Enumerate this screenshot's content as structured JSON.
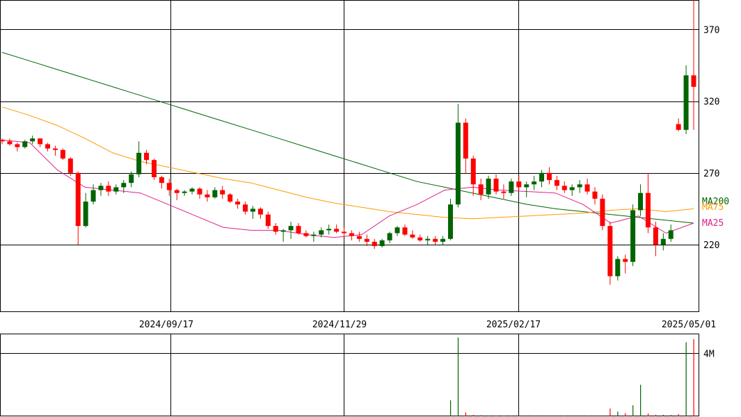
{
  "chart_data": {
    "type": "candlestick",
    "x_tick_labels": [
      "2024/09/17",
      "2024/11/29",
      "2025/02/17",
      "2025/05/01"
    ],
    "price_axis": {
      "ticks": [
        220,
        270,
        320,
        370
      ],
      "ylim": [
        173.5,
        390.5
      ]
    },
    "volume_axis": {
      "ticks": [
        {
          "value": 4000000,
          "label": "4M"
        }
      ],
      "ylim": [
        0,
        5200000
      ]
    },
    "grid": true,
    "moving_averages": [
      {
        "name": "MA200",
        "color": "#006400",
        "values": [
          354,
          348,
          342,
          336,
          330,
          324,
          318,
          312,
          306,
          300,
          294,
          288,
          282,
          276,
          270,
          264,
          260,
          256,
          252,
          248,
          245,
          243,
          241,
          239,
          237,
          235
        ]
      },
      {
        "name": "MA75",
        "color": "#ff9900",
        "values": [
          316,
          310,
          303,
          294,
          284,
          278,
          274,
          270,
          266,
          263,
          258,
          253,
          249,
          246,
          243,
          241,
          239,
          238,
          239,
          240,
          241,
          242,
          244,
          245,
          243,
          245
        ]
      },
      {
        "name": "MA25",
        "color": "#e0208a",
        "values": [
          293,
          291,
          272,
          260,
          258,
          256,
          248,
          240,
          232,
          230,
          230,
          227,
          225,
          227,
          240,
          248,
          258,
          260,
          258,
          257,
          256,
          248,
          235,
          240,
          228,
          235
        ]
      }
    ],
    "candles": [
      [
        293,
        294,
        290,
        292
      ],
      [
        292,
        294,
        289,
        290
      ],
      [
        290,
        291,
        285,
        288
      ],
      [
        288,
        293,
        287,
        292
      ],
      [
        292,
        296,
        290,
        294
      ],
      [
        294,
        294,
        288,
        290
      ],
      [
        290,
        291,
        285,
        287
      ],
      [
        287,
        289,
        282,
        286
      ],
      [
        286,
        287,
        279,
        280
      ],
      [
        280,
        281,
        268,
        270
      ],
      [
        270,
        271,
        220,
        233
      ],
      [
        233,
        256,
        232,
        250
      ],
      [
        250,
        262,
        248,
        258
      ],
      [
        258,
        263,
        254,
        261
      ],
      [
        261,
        264,
        254,
        257
      ],
      [
        257,
        262,
        255,
        260
      ],
      [
        260,
        265,
        256,
        263
      ],
      [
        263,
        271,
        260,
        269
      ],
      [
        269,
        292,
        267,
        284
      ],
      [
        284,
        286,
        276,
        279
      ],
      [
        279,
        280,
        265,
        267
      ],
      [
        267,
        268,
        259,
        263
      ],
      [
        263,
        266,
        254,
        258
      ],
      [
        258,
        259,
        251,
        256
      ],
      [
        256,
        258,
        254,
        257
      ],
      [
        257,
        260,
        255,
        259
      ],
      [
        259,
        260,
        252,
        255
      ],
      [
        255,
        258,
        250,
        253
      ],
      [
        253,
        260,
        252,
        258
      ],
      [
        258,
        261,
        252,
        255
      ],
      [
        255,
        256,
        249,
        250
      ],
      [
        250,
        252,
        245,
        248
      ],
      [
        248,
        250,
        241,
        243
      ],
      [
        243,
        247,
        238,
        245
      ],
      [
        245,
        246,
        238,
        241
      ],
      [
        241,
        243,
        231,
        233
      ],
      [
        233,
        235,
        227,
        229
      ],
      [
        229,
        231,
        222,
        230
      ],
      [
        230,
        236,
        224,
        233
      ],
      [
        233,
        235,
        227,
        228
      ],
      [
        228,
        230,
        225,
        226
      ],
      [
        226,
        229,
        222,
        227
      ],
      [
        227,
        232,
        225,
        230
      ],
      [
        230,
        234,
        227,
        231
      ],
      [
        231,
        234,
        228,
        229
      ],
      [
        229,
        232,
        226,
        228
      ],
      [
        228,
        230,
        223,
        226
      ],
      [
        226,
        229,
        222,
        224
      ],
      [
        224,
        227,
        219,
        222
      ],
      [
        222,
        224,
        217,
        219
      ],
      [
        219,
        224,
        218,
        223
      ],
      [
        223,
        229,
        221,
        228
      ],
      [
        228,
        233,
        226,
        232
      ],
      [
        232,
        234,
        226,
        227
      ],
      [
        227,
        230,
        224,
        225
      ],
      [
        225,
        227,
        222,
        223
      ],
      [
        223,
        226,
        220,
        224
      ],
      [
        224,
        226,
        220,
        222
      ],
      [
        222,
        226,
        220,
        224
      ],
      [
        224,
        252,
        223,
        248
      ],
      [
        248,
        318,
        246,
        305
      ],
      [
        305,
        308,
        270,
        280
      ],
      [
        280,
        282,
        254,
        262
      ],
      [
        262,
        266,
        251,
        255
      ],
      [
        255,
        268,
        252,
        266
      ],
      [
        266,
        269,
        255,
        257
      ],
      [
        257,
        262,
        252,
        256
      ],
      [
        256,
        266,
        254,
        264
      ],
      [
        264,
        268,
        258,
        260
      ],
      [
        260,
        264,
        253,
        262
      ],
      [
        262,
        268,
        258,
        264
      ],
      [
        264,
        272,
        260,
        270
      ],
      [
        270,
        274,
        262,
        265
      ],
      [
        265,
        268,
        258,
        261
      ],
      [
        261,
        264,
        256,
        258
      ],
      [
        258,
        262,
        254,
        260
      ],
      [
        260,
        265,
        256,
        262
      ],
      [
        262,
        266,
        255,
        257
      ],
      [
        257,
        260,
        248,
        252
      ],
      [
        252,
        255,
        230,
        233
      ],
      [
        233,
        236,
        192,
        198
      ],
      [
        198,
        212,
        195,
        210
      ],
      [
        210,
        213,
        200,
        208
      ],
      [
        208,
        248,
        205,
        244
      ],
      [
        244,
        262,
        240,
        256
      ],
      [
        256,
        270,
        228,
        232
      ],
      [
        232,
        236,
        212,
        220
      ],
      [
        220,
        228,
        216,
        224
      ],
      [
        224,
        234,
        222,
        230
      ],
      [
        304,
        308,
        299,
        300
      ],
      [
        300,
        345,
        297,
        338
      ],
      [
        338,
        392,
        300,
        330
      ]
    ],
    "volumes": [
      0,
      0,
      0,
      0,
      0,
      0,
      0,
      0,
      0,
      0,
      0,
      0,
      0,
      0,
      0,
      0,
      0,
      0,
      0,
      0,
      0,
      0,
      0,
      0,
      0,
      0,
      0,
      0,
      0,
      0,
      0,
      0,
      0,
      0,
      0,
      0,
      0,
      0,
      0,
      0,
      0,
      0,
      0,
      0,
      0,
      0,
      0,
      0,
      0,
      0,
      0,
      0,
      0,
      0,
      0,
      0,
      0,
      0,
      0,
      1020000,
      5000000,
      250000,
      90000,
      70000,
      50000,
      40000,
      40000,
      30000,
      30000,
      30000,
      30000,
      30000,
      30000,
      30000,
      30000,
      30000,
      30000,
      30000,
      30000,
      30000,
      500000,
      300000,
      200000,
      700000,
      2000000,
      180000,
      100000,
      90000,
      80000,
      140000,
      4700000,
      4900000
    ]
  }
}
